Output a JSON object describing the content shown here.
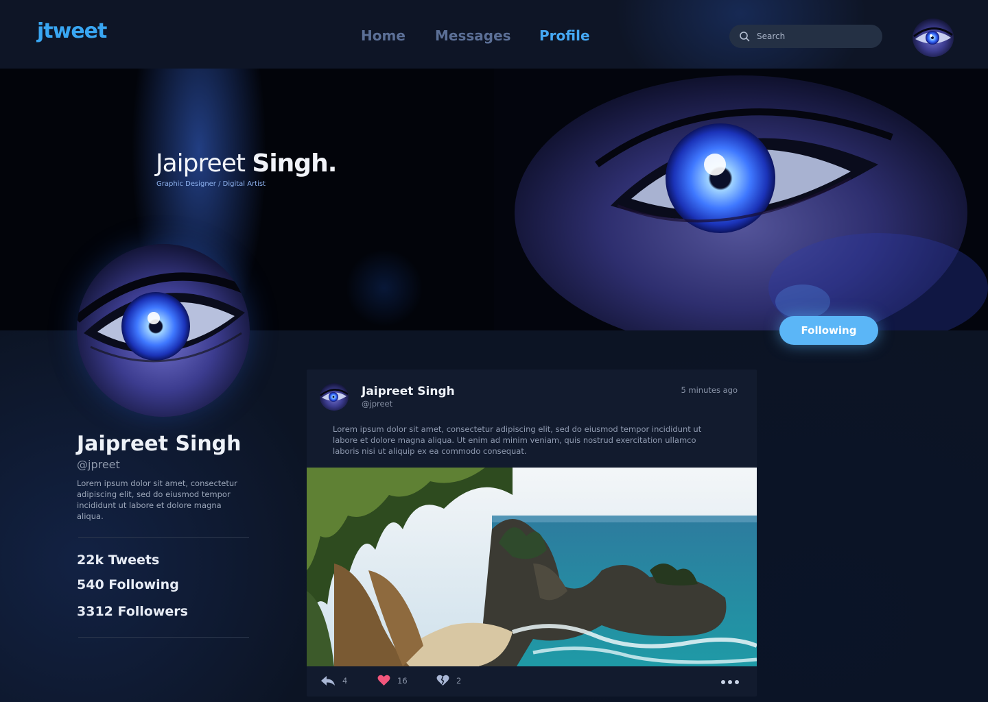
{
  "app": {
    "logo": "jtweet"
  },
  "nav": {
    "home": "Home",
    "messages": "Messages",
    "profile": "Profile"
  },
  "search": {
    "placeholder": "Search"
  },
  "banner": {
    "first_name": "Jaipreet",
    "last_name": "Singh.",
    "subtitle": "Graphic Designer / Digital Artist"
  },
  "profile": {
    "name": "Jaipreet Singh",
    "handle": "@jpreet",
    "bio": "Lorem ipsum dolor sit amet, consectetur adipiscing elit, sed do eiusmod tempor incididunt ut labore et dolore magna aliqua.",
    "follow_label": "Following",
    "stats": {
      "tweets": "22k Tweets",
      "following": "540 Following",
      "followers": "3312 Followers"
    }
  },
  "tweet": {
    "author": "Jaipreet Singh",
    "handle": "@jpreet",
    "time": "5 minutes ago",
    "text": "Lorem ipsum dolor sit amet, consectetur adipiscing elit, sed do eiusmod tempor incididunt ut labore et dolore magna aliqua. Ut enim ad minim veniam, quis nostrud exercitation ullamco laboris nisi ut aliquip ex ea commodo consequat.",
    "replies": "4",
    "likes": "16",
    "dislikes": "2"
  },
  "colors": {
    "accent": "#45a8f4",
    "button": "#5bb6f7",
    "like": "#f2567c",
    "background": "#0c1424"
  },
  "icons": [
    "search-icon",
    "reply-icon",
    "heart-icon",
    "broken-heart-icon",
    "more-icon"
  ]
}
